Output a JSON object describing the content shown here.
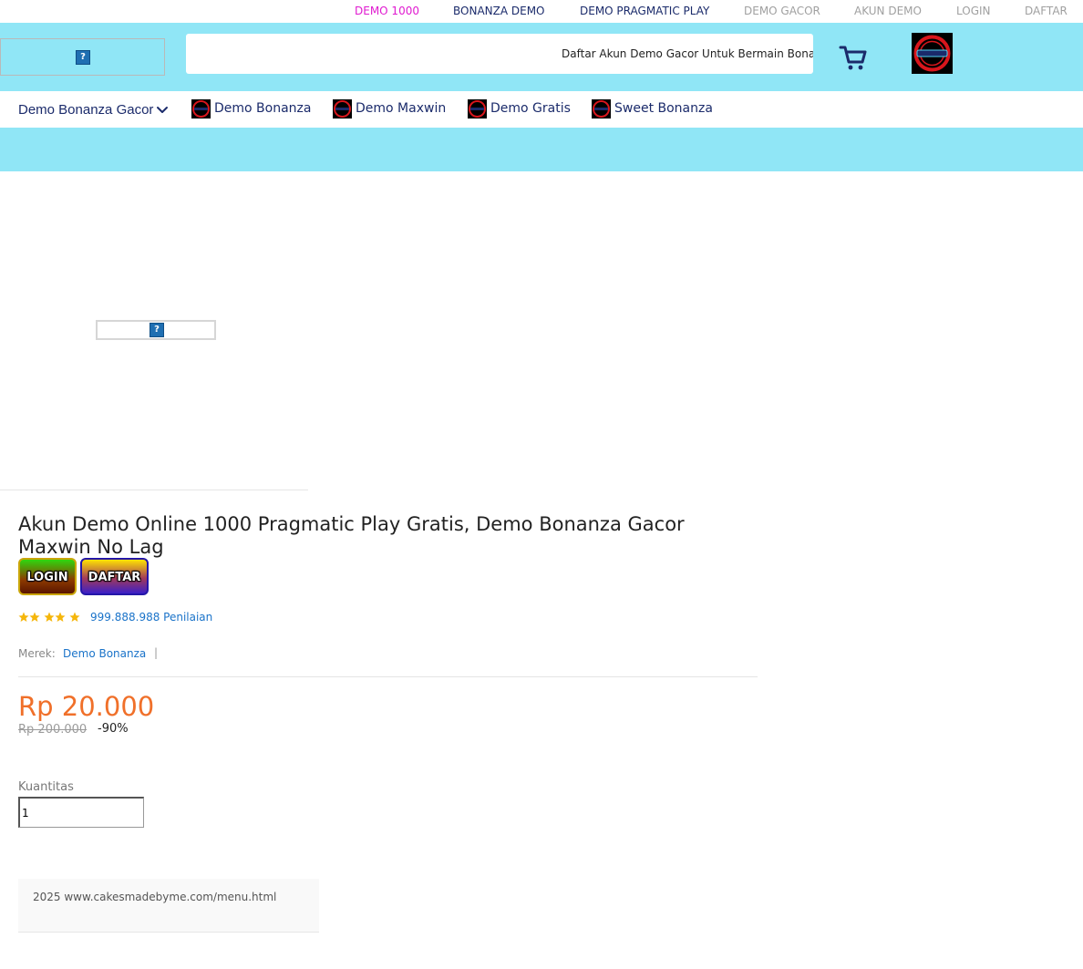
{
  "top_links": [
    {
      "label": "DEMO 1000",
      "color": "#e01bd0"
    },
    {
      "label": "BONANZA DEMO",
      "color": "#1b2b6b"
    },
    {
      "label": "DEMO PRAGMATIC PLAY",
      "color": "#1b2b6b"
    },
    {
      "label": "DEMO GACOR",
      "color": "#a0a0a0"
    },
    {
      "label": "AKUN DEMO",
      "color": "#a0a0a0"
    },
    {
      "label": "LOGIN",
      "color": "#a0a0a0"
    },
    {
      "label": "DAFTAR",
      "color": "#a0a0a0"
    }
  ],
  "header": {
    "search_text": "Daftar Akun Demo Gacor Untuk Bermain Bonanza",
    "cart_icon": "shopping-cart-icon",
    "accent_color": "#90e6f6"
  },
  "category_nav": {
    "selected": "Demo Bonanza Gacor",
    "items": [
      {
        "label": "Demo Bonanza"
      },
      {
        "label": "Demo Maxwin"
      },
      {
        "label": "Demo Gratis"
      },
      {
        "label": "Sweet Bonanza"
      }
    ]
  },
  "product": {
    "title": "Akun Demo Online 1000 Pragmatic Play Gratis, Demo Bonanza Gacor Maxwin No Lag",
    "login_label": "LOGIN",
    "daftar_label": "DAFTAR",
    "rating_stars": 5,
    "rating_text": "999.888.988 Penilaian",
    "brand_label": "Merek:",
    "brand_value": "Demo Bonanza",
    "brand_separator": "|",
    "price": "Rp 20.000",
    "old_price": "Rp 200.000",
    "discount": "-90%",
    "quantity_label": "Kuantitas",
    "quantity_value": "1",
    "price_color": "#f0702a"
  },
  "footer": {
    "text": "2025 www.cakesmadebyme.com/menu.html"
  }
}
